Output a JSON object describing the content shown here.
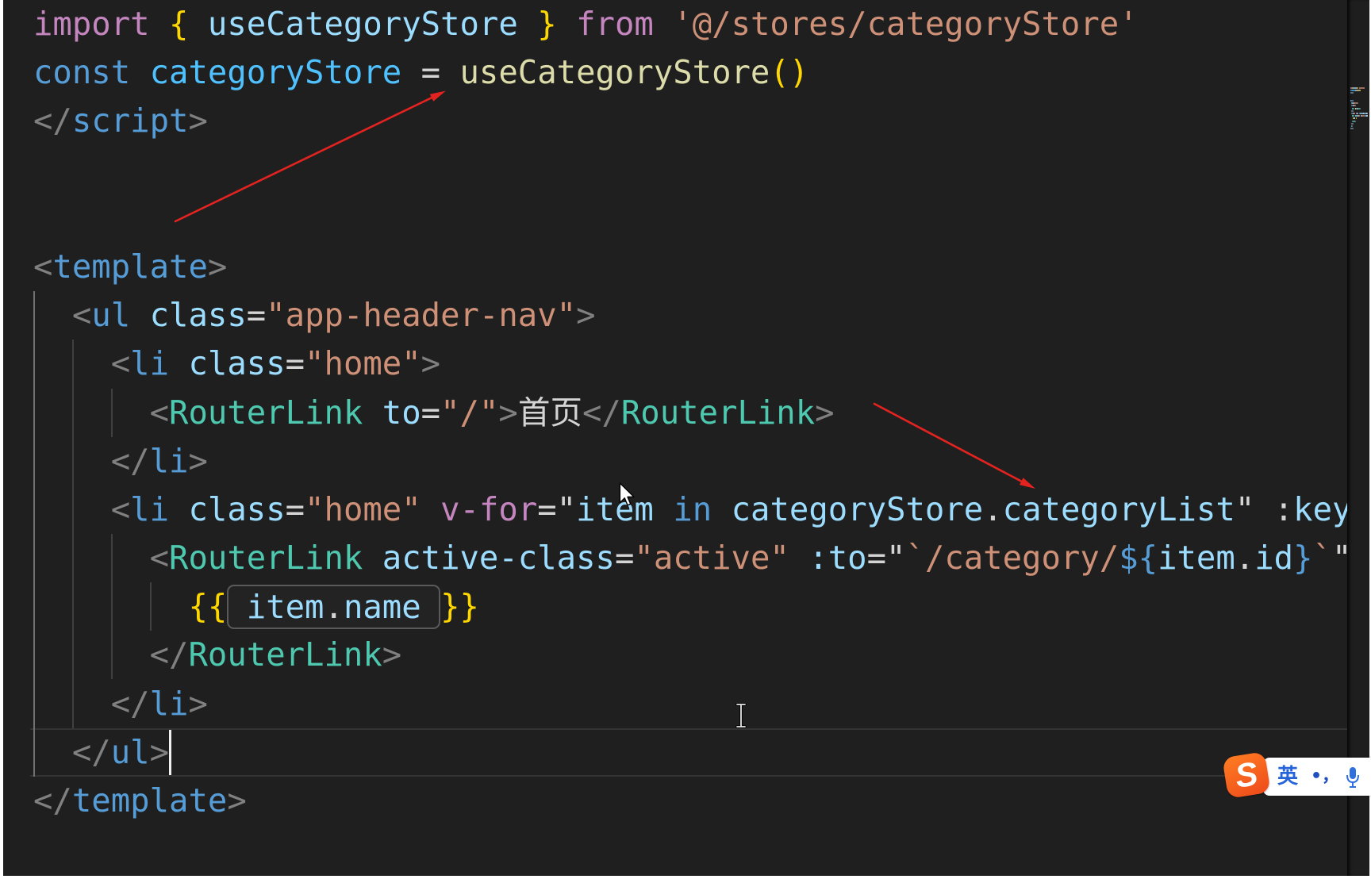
{
  "theme": {
    "editor_bg": "#1f1f1f",
    "minimap_bg": "#1e1e1e",
    "current_line_border": "#333333",
    "indent_guide": "#404040",
    "indent_guide_active": "#707070",
    "caret": "#f0f0f0",
    "annotation_arrow": "#e32320",
    "token_colors": {
      "control": "#C586C0",
      "keyword": "#569CD6",
      "brace": "#FFD700",
      "var": "#9CDCFE",
      "const": "#4FC1FF",
      "func": "#DCDCAA",
      "string": "#CE9178",
      "punct": "#808080",
      "tag": "#569CD6",
      "component": "#4EC9B0",
      "attr": "#9CDCFE",
      "text": "#D4D4D4"
    }
  },
  "editor": {
    "current_line": 16,
    "cursor": {
      "line": 16,
      "column": 8
    },
    "lines": [
      {
        "tokens": [
          {
            "t": "import",
            "k": "control"
          },
          {
            "t": " ",
            "k": "ws"
          },
          {
            "t": "{",
            "k": "brace"
          },
          {
            "t": " ",
            "k": "ws"
          },
          {
            "t": "useCategoryStore",
            "k": "var"
          },
          {
            "t": " ",
            "k": "ws"
          },
          {
            "t": "}",
            "k": "brace"
          },
          {
            "t": " ",
            "k": "ws"
          },
          {
            "t": "from",
            "k": "control"
          },
          {
            "t": " ",
            "k": "ws"
          },
          {
            "t": "'@/stores/categoryStore'",
            "k": "string"
          }
        ]
      },
      {
        "tokens": [
          {
            "t": "const",
            "k": "keyword"
          },
          {
            "t": " ",
            "k": "ws"
          },
          {
            "t": "categoryStore",
            "k": "const"
          },
          {
            "t": " = ",
            "k": "text"
          },
          {
            "t": "useCategoryStore",
            "k": "func"
          },
          {
            "t": "()",
            "k": "brace"
          }
        ]
      },
      {
        "tokens": [
          {
            "t": "</",
            "k": "punct"
          },
          {
            "t": "script",
            "k": "tag"
          },
          {
            "t": ">",
            "k": "punct"
          }
        ]
      },
      {
        "tokens": []
      },
      {
        "tokens": []
      },
      {
        "tokens": [
          {
            "t": "<",
            "k": "punct"
          },
          {
            "t": "template",
            "k": "tag"
          },
          {
            "t": ">",
            "k": "punct"
          }
        ]
      },
      {
        "tokens": [
          {
            "t": "  ",
            "k": "ws"
          },
          {
            "t": "<",
            "k": "punct"
          },
          {
            "t": "ul",
            "k": "tag"
          },
          {
            "t": " ",
            "k": "ws"
          },
          {
            "t": "class",
            "k": "attr"
          },
          {
            "t": "=",
            "k": "text"
          },
          {
            "t": "\"app-header-nav\"",
            "k": "string"
          },
          {
            "t": ">",
            "k": "punct"
          }
        ]
      },
      {
        "tokens": [
          {
            "t": "    ",
            "k": "ws"
          },
          {
            "t": "<",
            "k": "punct"
          },
          {
            "t": "li",
            "k": "tag"
          },
          {
            "t": " ",
            "k": "ws"
          },
          {
            "t": "class",
            "k": "attr"
          },
          {
            "t": "=",
            "k": "text"
          },
          {
            "t": "\"home\"",
            "k": "string"
          },
          {
            "t": ">",
            "k": "punct"
          }
        ]
      },
      {
        "tokens": [
          {
            "t": "      ",
            "k": "ws"
          },
          {
            "t": "<",
            "k": "punct"
          },
          {
            "t": "RouterLink",
            "k": "component"
          },
          {
            "t": " ",
            "k": "ws"
          },
          {
            "t": "to",
            "k": "attr"
          },
          {
            "t": "=",
            "k": "text"
          },
          {
            "t": "\"/\"",
            "k": "string"
          },
          {
            "t": ">",
            "k": "punct"
          },
          {
            "t": "首页",
            "k": "text"
          },
          {
            "t": "</",
            "k": "punct"
          },
          {
            "t": "RouterLink",
            "k": "component"
          },
          {
            "t": ">",
            "k": "punct"
          }
        ]
      },
      {
        "tokens": [
          {
            "t": "    ",
            "k": "ws"
          },
          {
            "t": "</",
            "k": "punct"
          },
          {
            "t": "li",
            "k": "tag"
          },
          {
            "t": ">",
            "k": "punct"
          }
        ]
      },
      {
        "tokens": [
          {
            "t": "    ",
            "k": "ws"
          },
          {
            "t": "<",
            "k": "punct"
          },
          {
            "t": "li",
            "k": "tag"
          },
          {
            "t": " ",
            "k": "ws"
          },
          {
            "t": "class",
            "k": "attr"
          },
          {
            "t": "=",
            "k": "text"
          },
          {
            "t": "\"home\"",
            "k": "string"
          },
          {
            "t": " ",
            "k": "ws"
          },
          {
            "t": "v-for",
            "k": "control"
          },
          {
            "t": "=\"",
            "k": "text"
          },
          {
            "t": "item",
            "k": "var"
          },
          {
            "t": " ",
            "k": "ws"
          },
          {
            "t": "in",
            "k": "keyword"
          },
          {
            "t": " ",
            "k": "ws"
          },
          {
            "t": "categoryStore",
            "k": "var"
          },
          {
            "t": ".",
            "k": "text"
          },
          {
            "t": "categoryList",
            "k": "var"
          },
          {
            "t": "\"",
            "k": "text"
          },
          {
            "t": " ",
            "k": "ws"
          },
          {
            "t": ":",
            "k": "text"
          },
          {
            "t": "key",
            "k": "attr"
          }
        ]
      },
      {
        "tokens": [
          {
            "t": "      ",
            "k": "ws"
          },
          {
            "t": "<",
            "k": "punct"
          },
          {
            "t": "RouterLink",
            "k": "component"
          },
          {
            "t": " ",
            "k": "ws"
          },
          {
            "t": "active-class",
            "k": "attr"
          },
          {
            "t": "=",
            "k": "text"
          },
          {
            "t": "\"active\"",
            "k": "string"
          },
          {
            "t": " ",
            "k": "ws"
          },
          {
            "t": ":to",
            "k": "attr"
          },
          {
            "t": "=\"",
            "k": "text"
          },
          {
            "t": "`/category/",
            "k": "string"
          },
          {
            "t": "${",
            "k": "keyword"
          },
          {
            "t": "item",
            "k": "var"
          },
          {
            "t": ".",
            "k": "text"
          },
          {
            "t": "id",
            "k": "var"
          },
          {
            "t": "}",
            "k": "keyword"
          },
          {
            "t": "`",
            "k": "string"
          },
          {
            "t": "\"",
            "k": "text"
          }
        ]
      },
      {
        "tokens": [
          {
            "t": "        ",
            "k": "ws"
          },
          {
            "t": "{{",
            "k": "brace"
          },
          {
            "t": " ",
            "k": "ws",
            "hl": true
          },
          {
            "t": "item",
            "k": "var",
            "hl": true
          },
          {
            "t": ".",
            "k": "text",
            "hl": true
          },
          {
            "t": "name",
            "k": "var",
            "hl": true
          },
          {
            "t": " ",
            "k": "ws",
            "hl": true
          },
          {
            "t": "}}",
            "k": "brace"
          }
        ]
      },
      {
        "tokens": [
          {
            "t": "      ",
            "k": "ws"
          },
          {
            "t": "</",
            "k": "punct"
          },
          {
            "t": "RouterLink",
            "k": "component"
          },
          {
            "t": ">",
            "k": "punct"
          }
        ]
      },
      {
        "tokens": [
          {
            "t": "    ",
            "k": "ws"
          },
          {
            "t": "</",
            "k": "punct"
          },
          {
            "t": "li",
            "k": "tag"
          },
          {
            "t": ">",
            "k": "punct"
          }
        ]
      },
      {
        "tokens": [
          {
            "t": "  ",
            "k": "ws"
          },
          {
            "t": "</",
            "k": "punct"
          },
          {
            "t": "ul",
            "k": "tag"
          },
          {
            "t": ">",
            "k": "punct"
          }
        ]
      },
      {
        "tokens": [
          {
            "t": "</",
            "k": "punct"
          },
          {
            "t": "template",
            "k": "tag"
          },
          {
            "t": ">",
            "k": "punct"
          }
        ]
      }
    ]
  },
  "ime": {
    "logo_letter": "S",
    "mode": "英",
    "punctuation": "•，",
    "logo_color": "#f15a22",
    "accent_color": "#2563d9",
    "icons": {
      "logo": "sogou-logo-icon",
      "mic": "microphone-icon"
    }
  },
  "pointers": {
    "mouse": "arrow-pointer-icon",
    "text": "ibeam-cursor-icon"
  }
}
